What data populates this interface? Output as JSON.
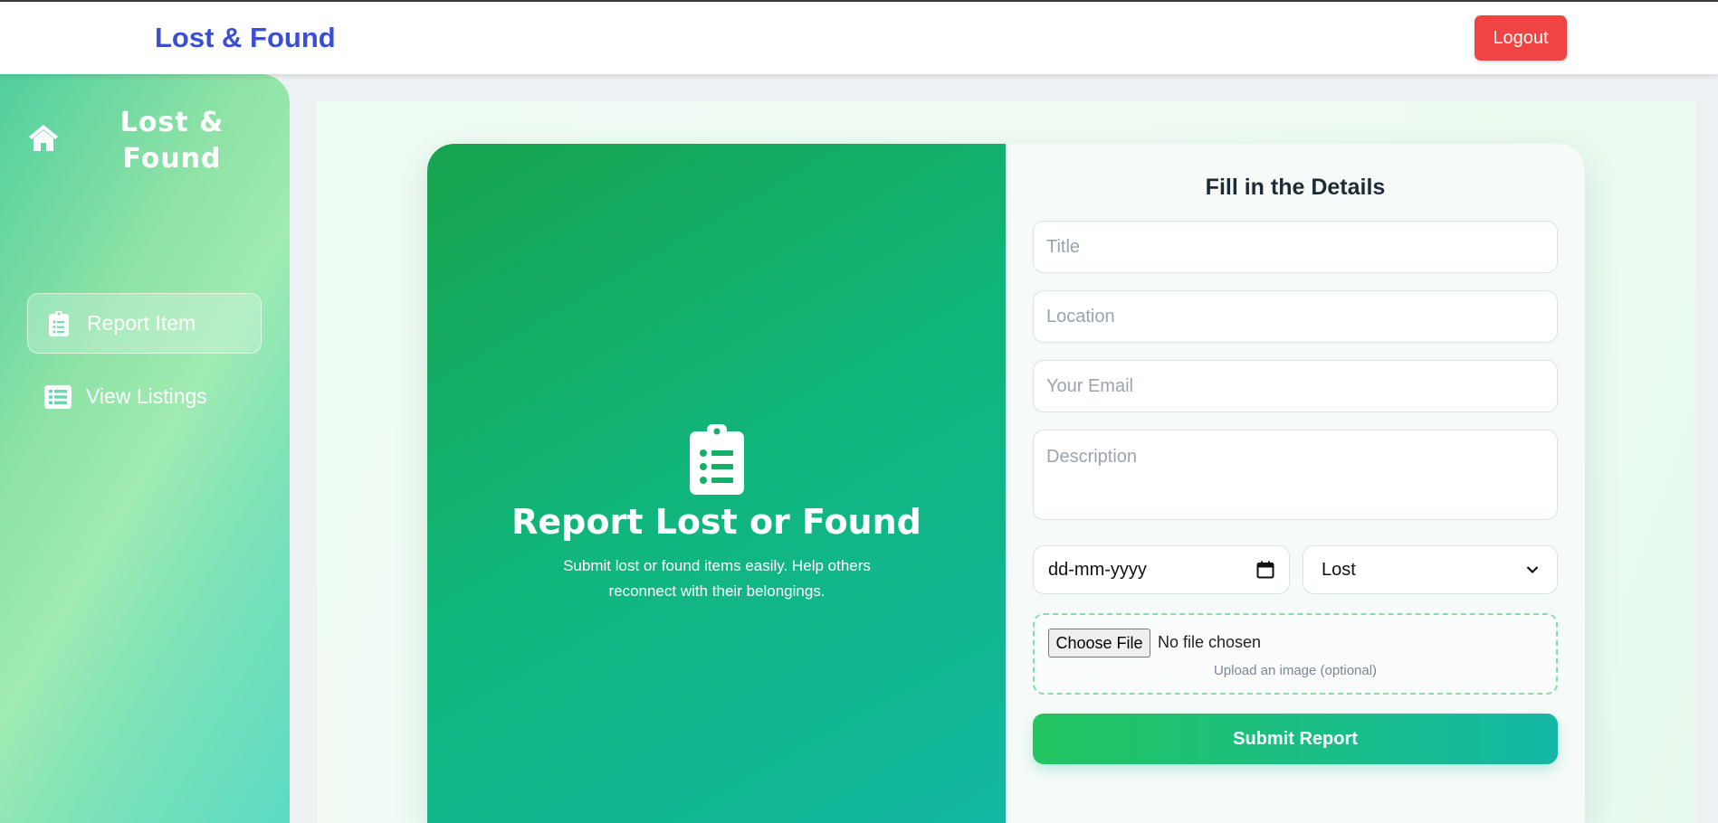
{
  "navbar": {
    "brand": "Lost & Found",
    "logout_label": "Logout"
  },
  "sidebar": {
    "brand": "Lost & Found",
    "brand_icon": "home-icon",
    "items": [
      {
        "label": "Report Item",
        "icon": "clipboard-list-icon",
        "active": true
      },
      {
        "label": "View Listings",
        "icon": "list-icon",
        "active": false
      }
    ]
  },
  "hero": {
    "icon": "clipboard-list-icon",
    "title": "Report Lost or Found",
    "subtitle": "Submit lost or found items easily. Help others reconnect with their belongings."
  },
  "form": {
    "title": "Fill in the Details",
    "title_placeholder": "Title",
    "location_placeholder": "Location",
    "email_placeholder": "Your Email",
    "description_placeholder": "Description",
    "date_placeholder": "dd-mm-yyyy",
    "type_selected": "Lost",
    "choose_file_label": "Choose File",
    "no_file_text": "No file chosen",
    "upload_hint": "Upload an image (optional)",
    "submit_label": "Submit Report"
  },
  "colors": {
    "brand_blue": "#3b4fd4",
    "logout_red": "#ef4444",
    "accent_green": "#22c55e",
    "accent_teal": "#14b8a6"
  }
}
